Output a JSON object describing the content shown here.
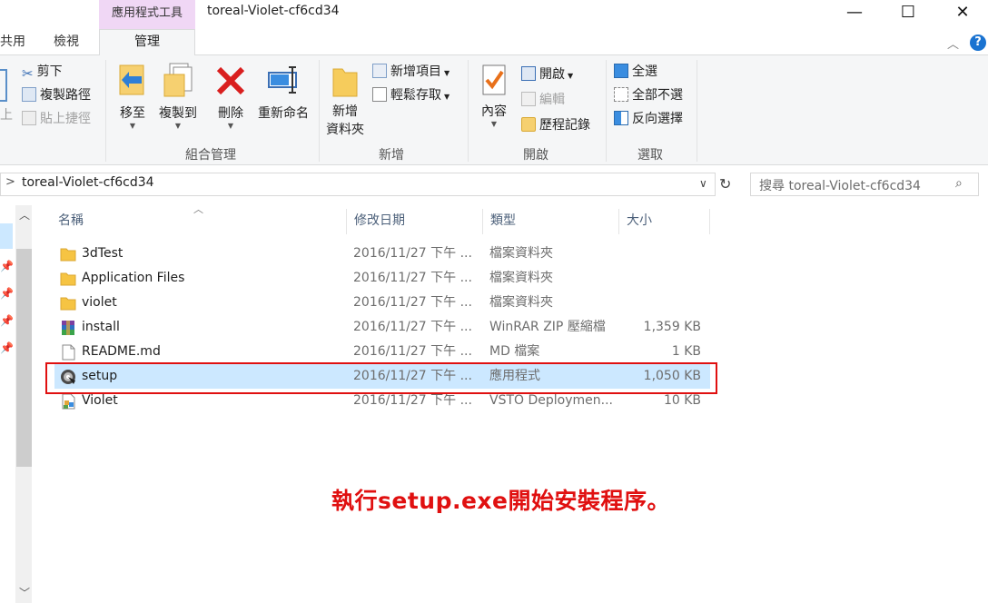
{
  "window": {
    "title": "toreal-Violet-cf6cd34",
    "context_tab_title": "應用程式工具",
    "controls": {
      "minimize": "—",
      "maximize": "☐",
      "close": "✕"
    }
  },
  "tabs": {
    "share": "共用",
    "view": "檢視",
    "manage": "管理"
  },
  "ribbon": {
    "clipboard": {
      "cut": "剪下",
      "copy_path": "複製路徑",
      "paste_shortcut": "貼上捷徑"
    },
    "organize": {
      "label": "組合管理",
      "move_to": "移至",
      "copy_to": "複製到",
      "delete": "刪除",
      "rename": "重新命名"
    },
    "new": {
      "label": "新增",
      "new_folder_line1": "新增",
      "new_folder_line2": "資料夾",
      "new_item": "新增項目",
      "easy_access": "輕鬆存取"
    },
    "open": {
      "label": "開啟",
      "properties": "內容",
      "open": "開啟",
      "edit": "編輯",
      "history": "歷程記錄"
    },
    "select": {
      "label": "選取",
      "select_all": "全選",
      "select_none": "全部不選",
      "invert": "反向選擇"
    }
  },
  "address": {
    "path": "toreal-Violet-cf6cd34",
    "search_placeholder": "搜尋 toreal-Violet-cf6cd34"
  },
  "columns": {
    "name": "名稱",
    "date": "修改日期",
    "type": "類型",
    "size": "大小"
  },
  "files": [
    {
      "name": "3dTest",
      "date": "2016/11/27 下午 ...",
      "type": "檔案資料夾",
      "size": "",
      "icon": "folder-icon"
    },
    {
      "name": "Application Files",
      "date": "2016/11/27 下午 ...",
      "type": "檔案資料夾",
      "size": "",
      "icon": "folder-icon"
    },
    {
      "name": "violet",
      "date": "2016/11/27 下午 ...",
      "type": "檔案資料夾",
      "size": "",
      "icon": "folder-icon"
    },
    {
      "name": "install",
      "date": "2016/11/27 下午 ...",
      "type": "WinRAR ZIP 壓縮檔",
      "size": "1,359 KB",
      "icon": "winrar-icon"
    },
    {
      "name": "README.md",
      "date": "2016/11/27 下午 ...",
      "type": "MD 檔案",
      "size": "1 KB",
      "icon": "document-icon"
    },
    {
      "name": "setup",
      "date": "2016/11/27 下午 ...",
      "type": "應用程式",
      "size": "1,050 KB",
      "icon": "setup-disc-icon"
    },
    {
      "name": "Violet",
      "date": "2016/11/27 下午 ...",
      "type": "VSTO Deploymen...",
      "size": "10 KB",
      "icon": "vsto-icon"
    }
  ],
  "selected_row": "setup",
  "annotation": "執行setup.exe開始安裝程序。",
  "colors": {
    "accent": "#1a73d1",
    "selection": "#cce8ff",
    "highlight": "#e01010",
    "context_tab": "#f0d7f5"
  }
}
